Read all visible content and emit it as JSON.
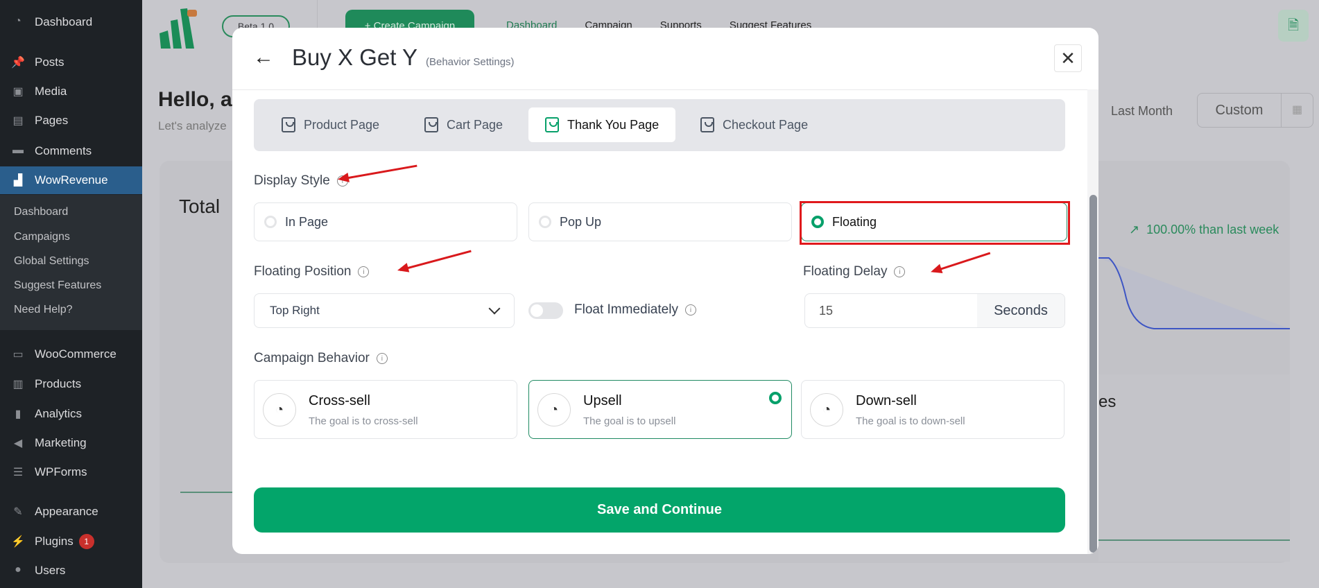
{
  "sidebar": {
    "items": [
      {
        "label": "Dashboard",
        "icon": "dashboard-icon"
      },
      {
        "label": "Posts",
        "icon": "pin-icon"
      },
      {
        "label": "Media",
        "icon": "media-icon"
      },
      {
        "label": "Pages",
        "icon": "pages-icon"
      },
      {
        "label": "Comments",
        "icon": "comment-icon"
      },
      {
        "label": "WowRevenue",
        "icon": "wowrevenue-icon",
        "active": true
      },
      {
        "label": "WooCommerce",
        "icon": "woo-icon"
      },
      {
        "label": "Products",
        "icon": "archive-icon"
      },
      {
        "label": "Analytics",
        "icon": "bar-chart-icon"
      },
      {
        "label": "Marketing",
        "icon": "megaphone-icon"
      },
      {
        "label": "WPForms",
        "icon": "form-icon"
      },
      {
        "label": "Appearance",
        "icon": "brush-icon"
      },
      {
        "label": "Plugins",
        "icon": "plug-icon",
        "badge": "1"
      },
      {
        "label": "Users",
        "icon": "user-icon"
      }
    ],
    "submenu": [
      "Dashboard",
      "Campaigns",
      "Global Settings",
      "Suggest Features",
      "Need Help?"
    ]
  },
  "background": {
    "beta": "Beta 1.0",
    "beta_tag": "BETA",
    "create_campaign": "+ Create Campaign",
    "nav": [
      "Dashboard",
      "Campaign",
      "Supports",
      "Suggest Features"
    ],
    "hello": "Hello, a",
    "subtitle": "Let's analyze",
    "total": "Total",
    "last_month": "Last Month",
    "custom": "Custom",
    "trend": "100.00% than last week",
    "partial_title": "es"
  },
  "modal": {
    "title": "Buy X Get Y",
    "subtitle": "(Behavior Settings)",
    "tabs": [
      {
        "label": "Product Page"
      },
      {
        "label": "Cart Page"
      },
      {
        "label": "Thank You Page",
        "active": true
      },
      {
        "label": "Checkout Page"
      }
    ],
    "display_style": {
      "label": "Display Style",
      "options": [
        "In Page",
        "Pop Up",
        "Floating"
      ],
      "selected": "Floating"
    },
    "floating_position": {
      "label": "Floating Position",
      "value": "Top Right"
    },
    "float_immediately": {
      "label": "Float Immediately",
      "on": false
    },
    "floating_delay": {
      "label": "Floating Delay",
      "value": "15",
      "unit": "Seconds"
    },
    "campaign_behavior": {
      "label": "Campaign Behavior",
      "options": [
        {
          "title": "Cross-sell",
          "desc": "The goal is to cross-sell"
        },
        {
          "title": "Upsell",
          "desc": "The goal is to upsell",
          "selected": true
        },
        {
          "title": "Down-sell",
          "desc": "The goal is to down-sell"
        }
      ]
    },
    "save": "Save and Continue"
  },
  "colors": {
    "accent": "#07a06a",
    "annotation": "#d9191c"
  }
}
